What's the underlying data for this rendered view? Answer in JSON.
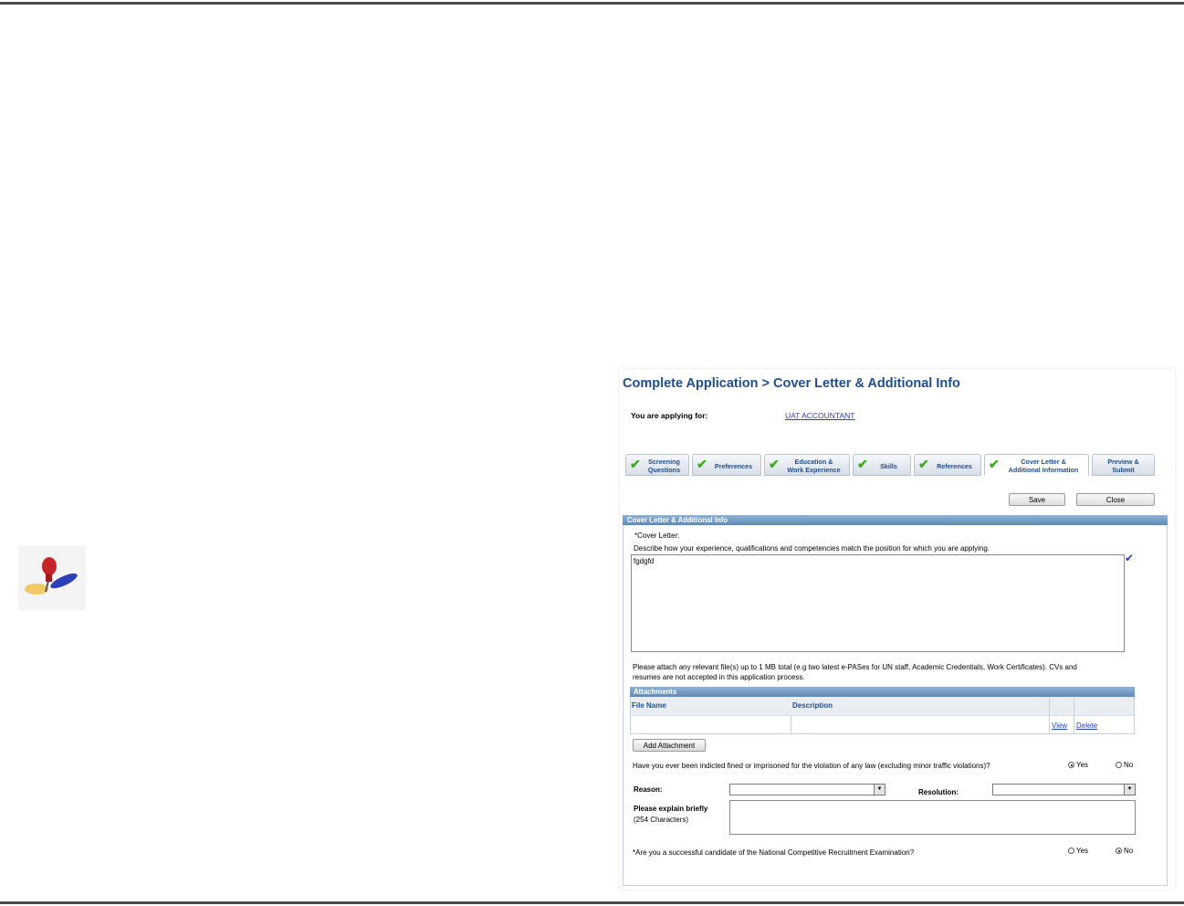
{
  "page": {
    "title": "Complete Application > Cover Letter & Additional Info",
    "applying_for_label": "You are applying for:",
    "job_link": "UAT ACCOUNTANT"
  },
  "tabs": [
    {
      "label": "Screening\nQuestions",
      "checked": true
    },
    {
      "label": "Preferences",
      "checked": true
    },
    {
      "label": "Education &\nWork Experience",
      "checked": true
    },
    {
      "label": "Skills",
      "checked": true
    },
    {
      "label": "References",
      "checked": true
    },
    {
      "label": "Cover Letter &\nAdditional Information",
      "checked": true,
      "active": true
    },
    {
      "label": "Preview &\nSubmit",
      "checked": false
    }
  ],
  "buttons": {
    "save": "Save",
    "close": "Close",
    "add_attachment": "Add Attachment"
  },
  "section": {
    "title": "Cover Letter & Additional Info",
    "cover_letter_label": "*Cover Letter:",
    "cover_letter_desc": "Describe how your experience, qualifications and competencies match the position for which you are applying.",
    "cover_letter_value": "fgdgfd",
    "attach_note_1": "Please attach any relevant file(s) up to 1 MB total (e.g two latest e-PASes for UN staff, Academic Credentials, Work Certificates). CVs and",
    "attach_note_2": "resumes are not accepted in this application process."
  },
  "attachments": {
    "title": "Attachments",
    "columns": [
      "File Name",
      "Description"
    ],
    "view_link": "View",
    "delete_link": "Delete"
  },
  "questions": {
    "indicted": "Have you ever been indicted fined or imprisoned for the violation of any law (excluding minor traffic violations)?",
    "indicted_yes": "Yes",
    "indicted_no": "No",
    "indicted_selected": "Yes",
    "reason_label": "Reason:",
    "resolution_label": "Resolution:",
    "explain_label": "Please explain briefly",
    "explain_hint": "(254 Characters)",
    "ncre": "*Are you a successful candidate of the National Competitive Recruitment Examination?",
    "ncre_yes": "Yes",
    "ncre_no": "No",
    "ncre_selected": "No"
  },
  "colors": {
    "title": "#1f4e8c",
    "link": "#2a3fb8",
    "check": "#3cab1f",
    "section_bar": "#6f97be"
  }
}
